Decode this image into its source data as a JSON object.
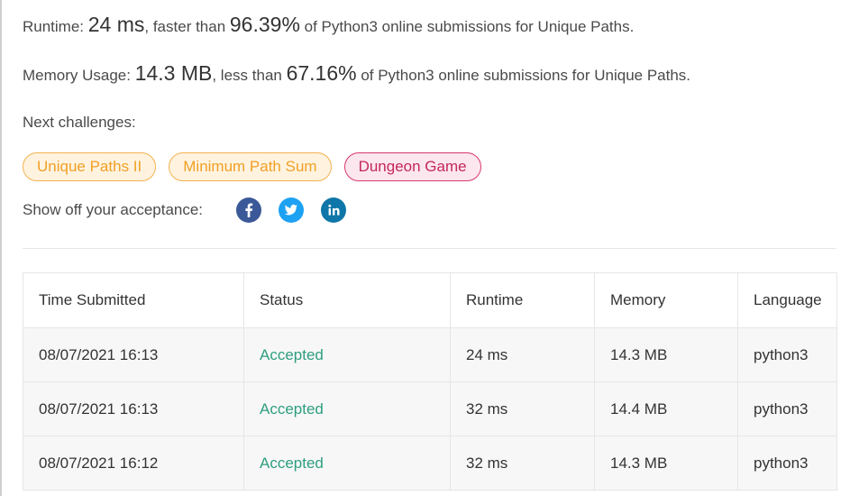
{
  "runtime": {
    "label": "Runtime: ",
    "value": "24 ms",
    "mid": ", faster than ",
    "percent": "96.39%",
    "suffix": " of Python3 online submissions for Unique Paths."
  },
  "memory": {
    "label": "Memory Usage: ",
    "value": "14.3 MB",
    "mid": ", less than ",
    "percent": "67.16%",
    "suffix": " of Python3 online submissions for Unique Paths."
  },
  "next_challenges": {
    "label": "Next challenges:",
    "items": [
      {
        "label": "Unique Paths II",
        "difficulty": "medium"
      },
      {
        "label": "Minimum Path Sum",
        "difficulty": "medium"
      },
      {
        "label": "Dungeon Game",
        "difficulty": "hard"
      }
    ]
  },
  "share": {
    "label": "Show off your acceptance:",
    "icons": [
      "facebook-icon",
      "twitter-icon",
      "linkedin-icon"
    ]
  },
  "table": {
    "headers": [
      "Time Submitted",
      "Status",
      "Runtime",
      "Memory",
      "Language"
    ],
    "rows": [
      [
        "08/07/2021 16:13",
        "Accepted",
        "24 ms",
        "14.3 MB",
        "python3"
      ],
      [
        "08/07/2021 16:13",
        "Accepted",
        "32 ms",
        "14.4 MB",
        "python3"
      ],
      [
        "08/07/2021 16:12",
        "Accepted",
        "32 ms",
        "14.3 MB",
        "python3"
      ]
    ]
  },
  "colors": {
    "accepted": "#2e9e7f",
    "medium": "#f0a025",
    "hard": "#c3285b",
    "facebook": "#3b5998",
    "twitter": "#1da1f2",
    "linkedin": "#0e76a8"
  }
}
